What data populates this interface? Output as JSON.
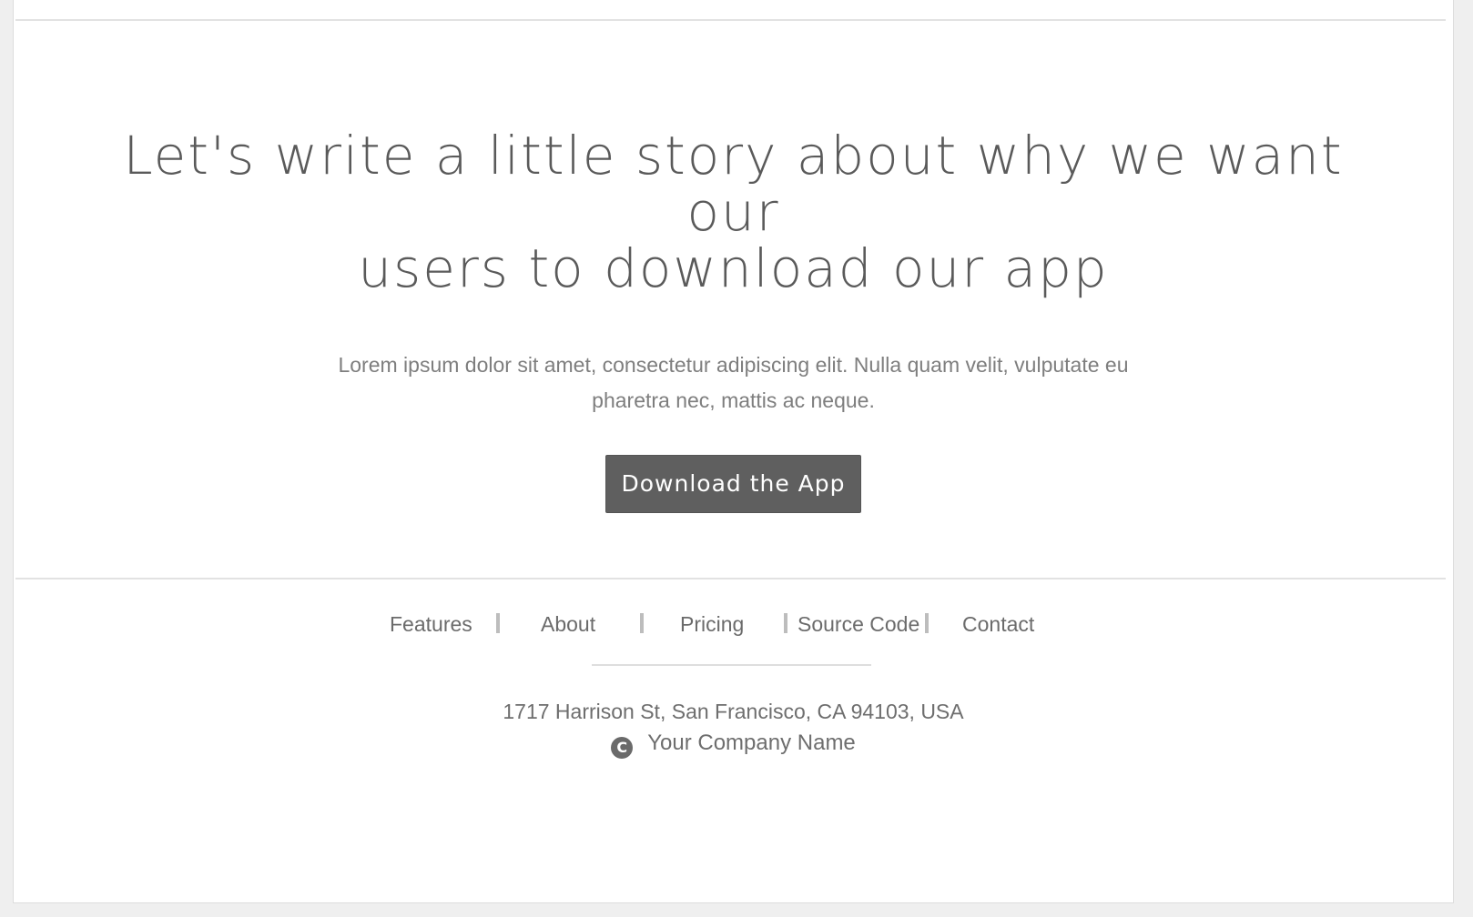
{
  "hero": {
    "headline_line1": "Let's write a little story about why we want our",
    "headline_line2": "users to download our app",
    "subtext_line1": "Lorem ipsum dolor sit amet, consectetur adipiscing elit. Nulla quam velit, vulputate eu",
    "subtext_line2": "pharetra nec, mattis ac neque.",
    "cta_label": "Download the App"
  },
  "footer": {
    "nav": [
      {
        "label": "Features"
      },
      {
        "label": "About"
      },
      {
        "label": "Pricing"
      },
      {
        "label": "Source Code"
      },
      {
        "label": "Contact"
      }
    ],
    "address": "1717 Harrison St, San Francisco, CA 94103, USA",
    "copyright_icon": "copyright-icon",
    "company": "Your Company Name"
  },
  "colors": {
    "background": "#efefef",
    "text": "#5b5b5b",
    "button": "#5f5f5f",
    "separator": "#bdbdbd"
  }
}
